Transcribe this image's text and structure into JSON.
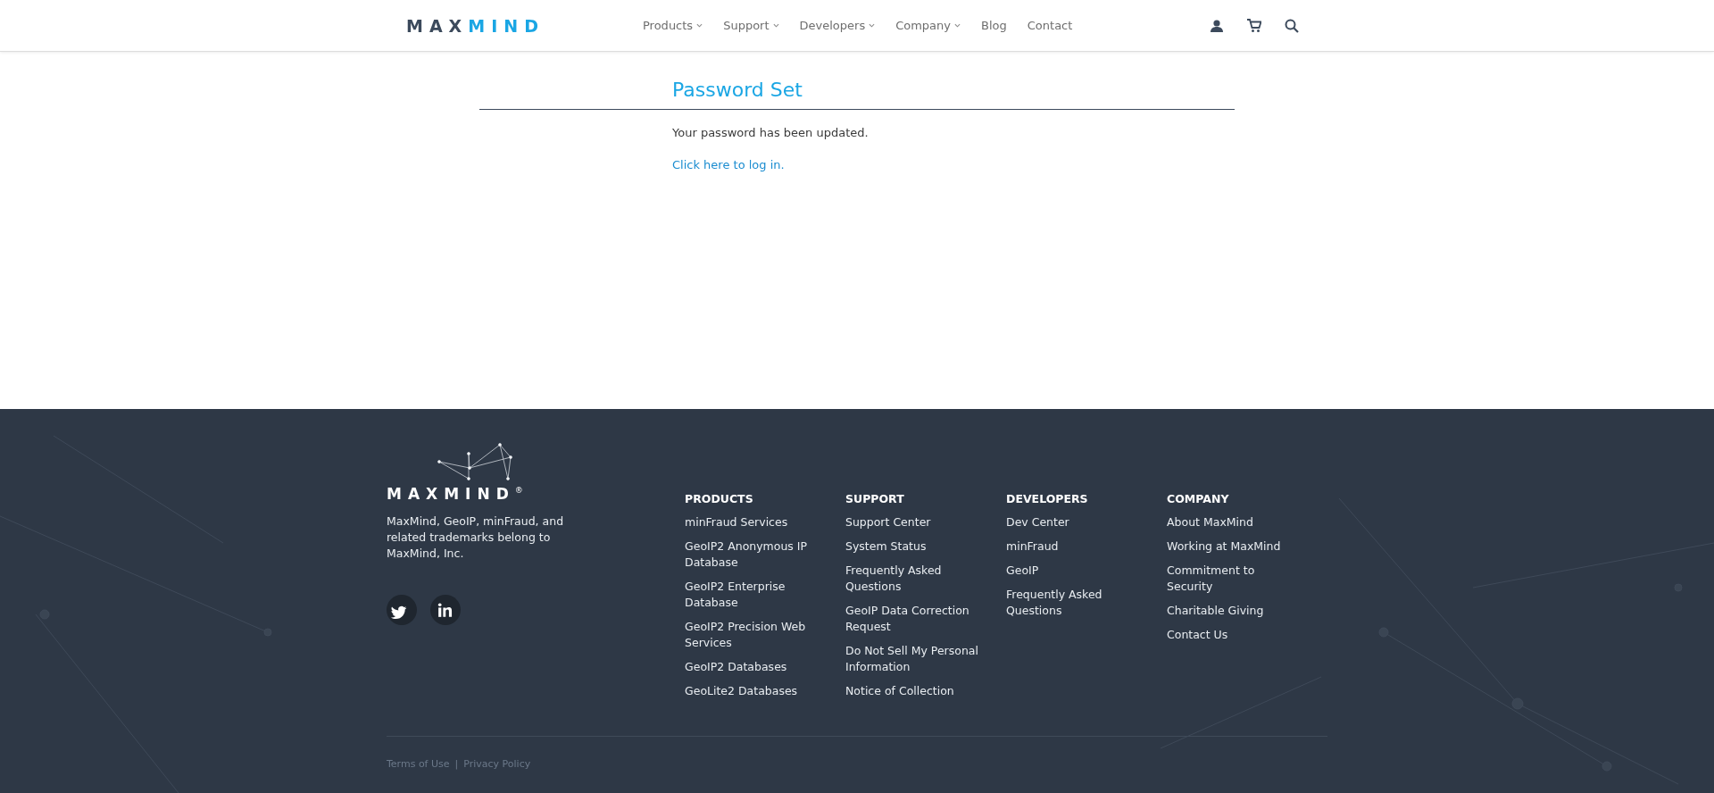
{
  "header": {
    "logo": [
      {
        "text": "MAX",
        "accent": false
      },
      {
        "text": "MIND",
        "accent": true
      }
    ],
    "nav": [
      {
        "label": "Products",
        "has_menu": true
      },
      {
        "label": "Support",
        "has_menu": true
      },
      {
        "label": "Developers",
        "has_menu": true
      },
      {
        "label": "Company",
        "has_menu": true
      },
      {
        "label": "Blog",
        "has_menu": false
      },
      {
        "label": "Contact",
        "has_menu": false
      }
    ],
    "icons": [
      {
        "kind": "account"
      },
      {
        "kind": "cart"
      },
      {
        "kind": "search"
      }
    ]
  },
  "main": {
    "title": "Password Set",
    "message": "Your password has been updated.",
    "link": "Click here to log in."
  },
  "footer": {
    "logo": "MAXMIND$^{®}$",
    "legal": "MaxMind, GeoIP, minFraud, and related trademarks belong to MaxMind, Inc.",
    "social": [
      {
        "kind": "twitter"
      },
      {
        "kind": "linkedin"
      }
    ],
    "columns": [
      {
        "heading": "PRODUCTS",
        "links": [
          "minFraud Services",
          "GeoIP2 Anonymous IP Database",
          "GeoIP2 Enterprise Database",
          "GeoIP2 Precision Web Services",
          "GeoIP2 Databases",
          "GeoLite2 Databases"
        ]
      },
      {
        "heading": "SUPPORT",
        "links": [
          "Support Center",
          "System Status",
          "Frequently Asked Questions",
          "GeoIP Data Correction Request",
          "Do Not Sell My Personal Information",
          "Notice of Collection"
        ]
      },
      {
        "heading": "DEVELOPERS",
        "links": [
          "Dev Center",
          "minFraud",
          "GeoIP",
          "Frequently Asked Questions"
        ]
      },
      {
        "heading": "COMPANY",
        "links": [
          "About MaxMind",
          "Working at MaxMind",
          "Commitment to Security",
          "Charitable Giving",
          "Contact Us"
        ]
      }
    ],
    "bottom_links": [
      "Terms of Use",
      "Privacy Policy"
    ],
    "separator": "|"
  }
}
